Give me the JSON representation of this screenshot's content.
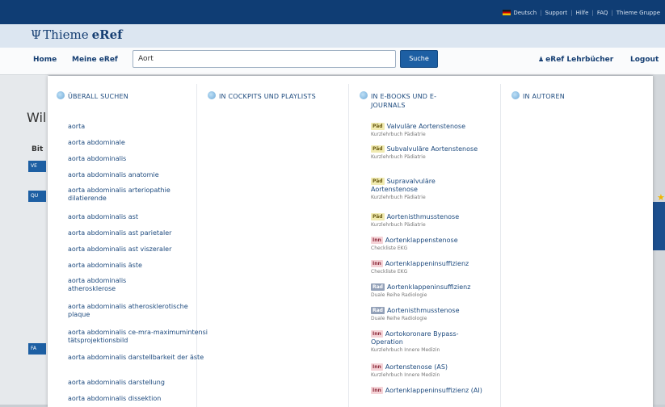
{
  "topbar": {
    "links": [
      "Deutsch",
      "Support",
      "Hilfe",
      "FAQ",
      "Thieme Gruppe"
    ]
  },
  "header": {
    "brand": "Thieme",
    "product": "eRef"
  },
  "nav": {
    "home": "Home",
    "meine": "Meine eRef",
    "lehrbuecher": "eRef Lehrbücher",
    "logout": "Logout"
  },
  "search": {
    "value": "Aort",
    "button": "Suche"
  },
  "background": {
    "title": "Wil",
    "label": "Bit",
    "tags": [
      "VE",
      "QU",
      "FA"
    ]
  },
  "dropdown": {
    "columns": [
      {
        "title": "ÜBERALL SUCHEN"
      },
      {
        "title": "IN COCKPITS UND PLAYLISTS"
      },
      {
        "title": "IN E-BOOKS UND E-JOURNALS"
      },
      {
        "title": "IN AUTOREN"
      }
    ],
    "suggestions": [
      "aorta",
      "aorta abdominale",
      "aorta abdominalis",
      "aorta abdominalis anatomie",
      "aorta abdominalis arteriopathie dilatierende",
      "aorta abdominalis ast",
      "aorta abdominalis ast parietaler",
      "aorta abdominalis ast viszeraler",
      "aorta abdominalis äste",
      "aorta abdominalis atherosklerose",
      "aorta abdominalis atherosklerotische plaque",
      "aorta abdominalis ce-mra-maximumintensitätsprojektionsbild",
      "aorta abdominalis darstellbarkeit der äste",
      "aorta abdominalis darstellung",
      "aorta abdominalis dissektion"
    ],
    "books": [
      {
        "badge": "Päd",
        "title": "Valvuläre Aortenstenose",
        "source": "Kurzlehrbuch Pädiatrie"
      },
      {
        "badge": "Päd",
        "title": "Subvalvuläre Aortenstenose",
        "source": "Kurzlehrbuch Pädiatrie"
      },
      {
        "badge": "Päd",
        "title": "Supravalvuläre Aortenstenose",
        "source": "Kurzlehrbuch Pädiatrie"
      },
      {
        "badge": "Päd",
        "title": "Aortenisthmusstenose",
        "source": "Kurzlehrbuch Pädiatrie"
      },
      {
        "badge": "Inn",
        "title": "Aortenklappenstenose",
        "source": "Checkliste EKG"
      },
      {
        "badge": "Inn",
        "title": "Aortenklappeninsuffizienz",
        "source": "Checkliste EKG"
      },
      {
        "badge": "Rad",
        "title": "Aortenklappeninsuffizienz",
        "source": "Duale Reihe Radiologie"
      },
      {
        "badge": "Rad",
        "title": "Aortenisthmusstenose",
        "source": "Duale Reihe Radiologie"
      },
      {
        "badge": "Inn",
        "title": "Aortokoronare Bypass-Operation",
        "source": "Kurzlehrbuch Innere Medizin"
      },
      {
        "badge": "Inn",
        "title": "Aortenstenose (AS)",
        "source": "Kurzlehrbuch Innere Medizin"
      },
      {
        "badge": "Inn",
        "title": "Aortenklappeninsuffizienz (AI)",
        "source": ""
      }
    ]
  }
}
